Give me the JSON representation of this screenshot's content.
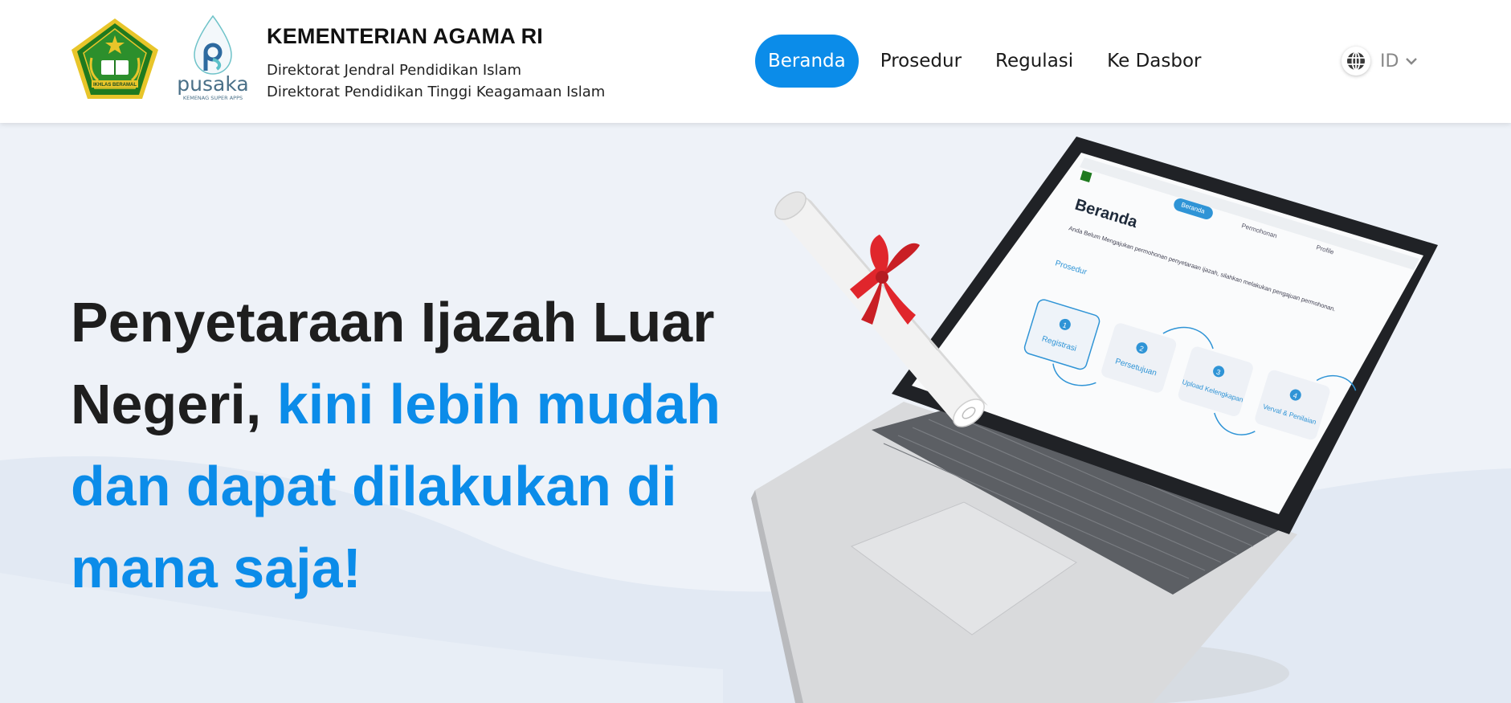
{
  "header": {
    "org_name": "KEMENTERIAN AGAMA RI",
    "org_sub_1": "Direktorat Jendral Pendidikan Islam",
    "org_sub_2": "Direktorat Pendidikan Tinggi Keagamaan Islam",
    "pusaka_text": "pusaka",
    "pusaka_tagline": "KEMENAG SUPER APPS",
    "kemenag_seal_text": "IKHLAS BERAMAL"
  },
  "nav": {
    "items": [
      {
        "label": "Beranda",
        "active": true
      },
      {
        "label": "Prosedur",
        "active": false
      },
      {
        "label": "Regulasi",
        "active": false
      },
      {
        "label": "Ke Dasbor",
        "active": false
      }
    ],
    "language": "ID"
  },
  "hero": {
    "headline_dark": "Penyetaraan Ijazah Luar Negeri, ",
    "headline_blue": "kini lebih mudah dan dapat dilakukan di mana saja!"
  },
  "screen": {
    "title": "Beranda",
    "tabs": [
      "Beranda",
      "Permohonan",
      "Profile"
    ],
    "notice": "Anda Belum Mengajukan permohonan penyetaraan ijazah, silahkan melakukan pengajuan permohonan.",
    "section": "Prosedur",
    "steps": [
      {
        "num": "1",
        "label": "Registrasi"
      },
      {
        "num": "2",
        "label": "Persetujuan"
      },
      {
        "num": "3",
        "label": "Upload Kelengkapan"
      },
      {
        "num": "4",
        "label": "Verval & Penilaian"
      }
    ]
  },
  "colors": {
    "accent": "#0b8ce9",
    "heading": "#1e1e1e",
    "hero_bg": "#eef2f8",
    "seal_green": "#1f7a1f",
    "seal_gold": "#e8c52a",
    "ribbon_red": "#e0262c"
  }
}
